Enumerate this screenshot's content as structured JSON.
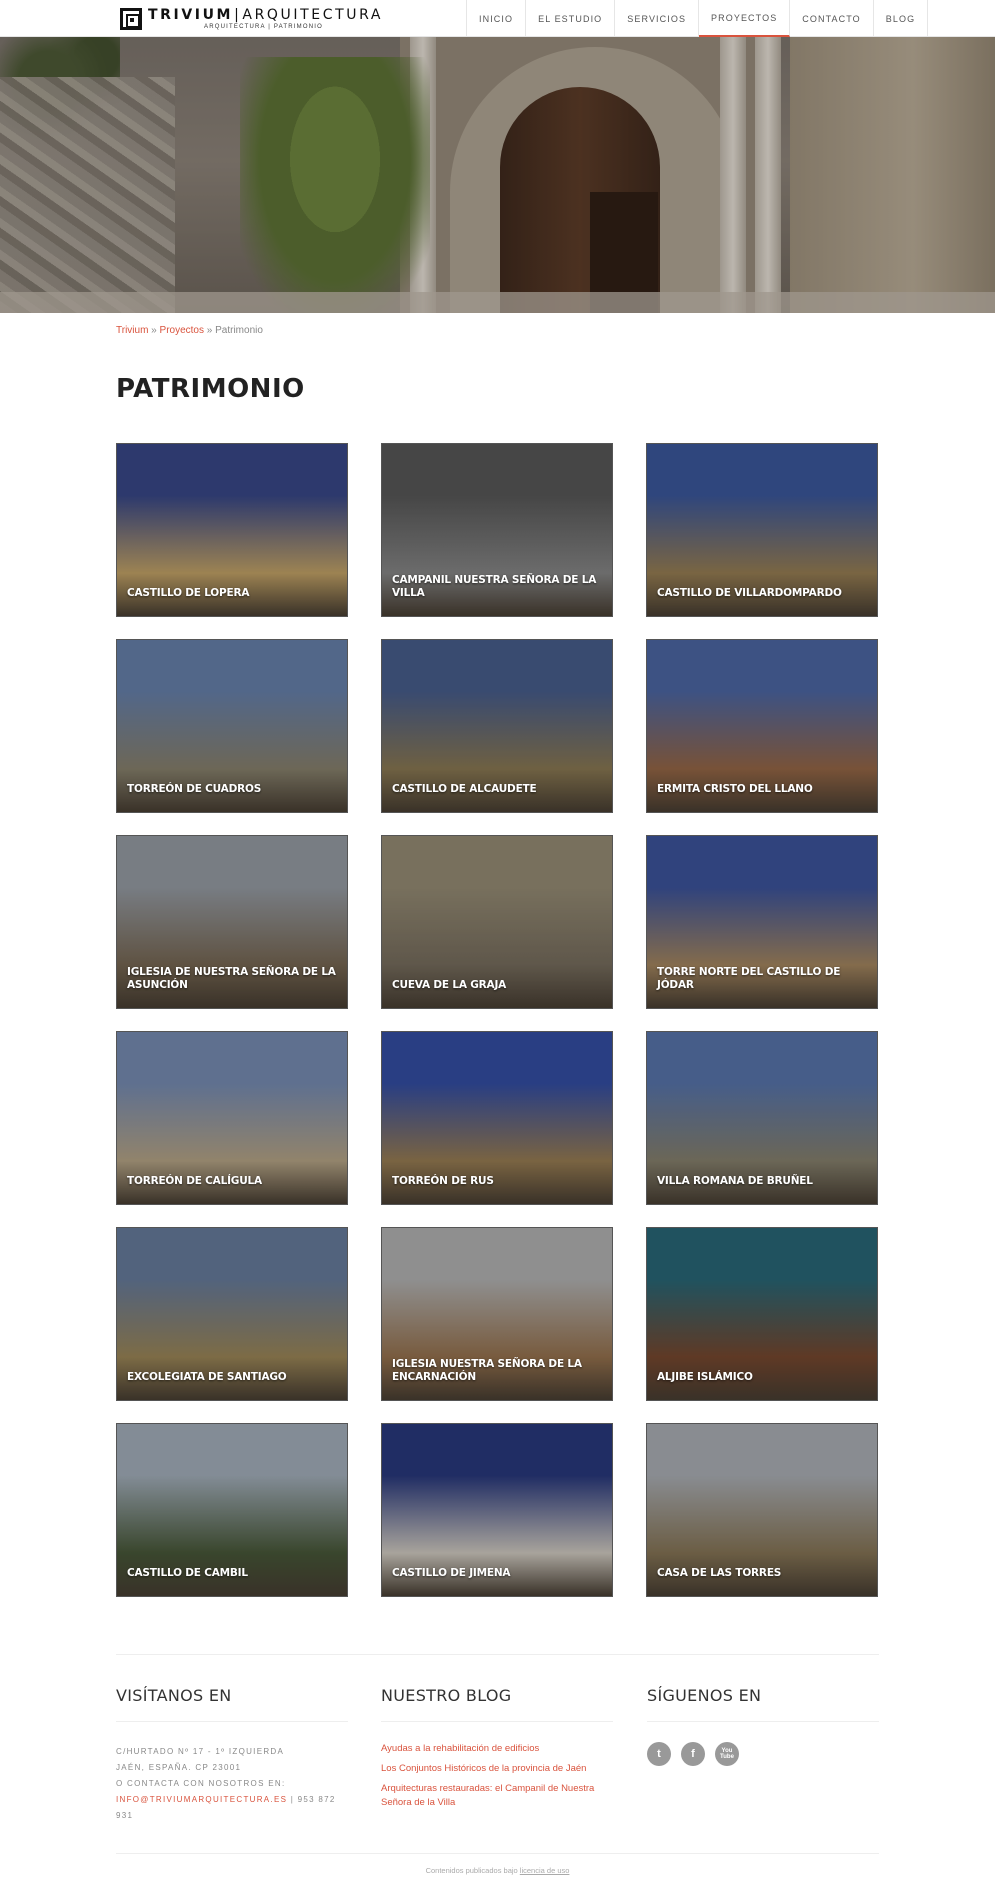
{
  "brand": {
    "name_part1": "TRIVIUM",
    "separator": "|",
    "name_part2": "ARQUITECTURA",
    "tagline": "ARQUITECTURA | PATRIMONIO"
  },
  "nav": {
    "items": [
      {
        "label": "INICIO"
      },
      {
        "label": "EL ESTUDIO"
      },
      {
        "label": "SERVICIOS"
      },
      {
        "label": "PROYECTOS"
      },
      {
        "label": "CONTACTO"
      },
      {
        "label": "BLOG"
      }
    ],
    "active": "PROYECTOS"
  },
  "breadcrumb": {
    "home": "Trivium",
    "sep1": " » ",
    "section": "Proyectos",
    "sep2": " » ",
    "current": "Patrimonio"
  },
  "page": {
    "title": "PATRIMONIO"
  },
  "projects": [
    {
      "title": "CASTILLO DE LOPERA",
      "colors": [
        "#3a4a8c",
        "#c9a86a"
      ]
    },
    {
      "title": "CAMPANIL NUESTRA SEÑORA DE LA VILLA",
      "colors": [
        "#5a5a5a",
        "#8a8a8a"
      ]
    },
    {
      "title": "CASTILLO DE VILLARDOMPARDO",
      "colors": [
        "#3d5aa0",
        "#9c8256"
      ]
    },
    {
      "title": "TORREÓN DE CUADROS",
      "colors": [
        "#6a85b0",
        "#8c8570"
      ]
    },
    {
      "title": "CASTILLO DE ALCAUDETE",
      "colors": [
        "#4a6090",
        "#8e7c55"
      ]
    },
    {
      "title": "ERMITA CRISTO DEL LLANO",
      "colors": [
        "#4f6aa8",
        "#9a6a48"
      ]
    },
    {
      "title": "IGLESIA DE NUESTRA SEÑORA DE LA ASUNCIÓN",
      "colors": [
        "#9aa0a8",
        "#7a6a55"
      ]
    },
    {
      "title": "CUEVA DE LA GRAJA",
      "colors": [
        "#9a9078",
        "#7a7060"
      ]
    },
    {
      "title": "TORRE NORTE DEL CASTILLO DE JÓDAR",
      "colors": [
        "#3e56a0",
        "#a98a62"
      ]
    },
    {
      "title": "TORREÓN DE CALÍGULA",
      "colors": [
        "#7a90b8",
        "#bba98a"
      ]
    },
    {
      "title": "TORREÓN DE RUS",
      "colors": [
        "#3550a8",
        "#9c8055"
      ]
    },
    {
      "title": "VILLA ROMANA DE BRUÑEL",
      "colors": [
        "#5a78b0",
        "#8a8470"
      ]
    },
    {
      "title": "EXCOLEGIATA DE SANTIAGO",
      "colors": [
        "#6a7fa0",
        "#a08a5a"
      ]
    },
    {
      "title": "IGLESIA NUESTRA SEÑORA DE LA ENCARNACIÓN",
      "colors": [
        "#b8b8b8",
        "#9a7550"
      ]
    },
    {
      "title": "ALJIBE ISLÁMICO",
      "colors": [
        "#2a6a7a",
        "#7a4a30"
      ]
    },
    {
      "title": "CASTILLO DE CAMBIL",
      "colors": [
        "#a8b4c0",
        "#4a5a3a"
      ]
    },
    {
      "title": "CASTILLO DE JIMENA",
      "colors": [
        "#2a3a80",
        "#d8d2c8"
      ]
    },
    {
      "title": "CASA DE LAS TORRES",
      "colors": [
        "#b0b4ba",
        "#8a7858"
      ]
    }
  ],
  "footer": {
    "visit": {
      "heading": "VISÍTANOS EN",
      "line1": "C/HURTADO Nº 17 - 1º IZQUIERDA",
      "line2": "JAÉN, ESPAÑA. CP 23001",
      "line3": "O CONTACTA CON NOSOTROS EN:",
      "email": "INFO@TRIVIUMARQUITECTURA.ES",
      "phone": " | 953 872 931"
    },
    "blog": {
      "heading": "NUESTRO BLOG",
      "links": [
        "Ayudas a la rehabilitación de edificios",
        "Los Conjuntos Históricos de la provincia de Jaén",
        "Arquitecturas restauradas: el Campanil de Nuestra Señora de la Villa"
      ]
    },
    "follow": {
      "heading": "SÍGUENOS EN",
      "icons": [
        "twitter-icon",
        "facebook-icon",
        "youtube-icon"
      ],
      "twitter_glyph": "t",
      "facebook_glyph": "f",
      "youtube_glyph": "You Tube"
    },
    "legal_text": "Contenidos publicados bajo ",
    "legal_link": "licencia de uso"
  },
  "colors": {
    "accent": "#d9533d",
    "text": "#333333",
    "muted": "#888888"
  }
}
